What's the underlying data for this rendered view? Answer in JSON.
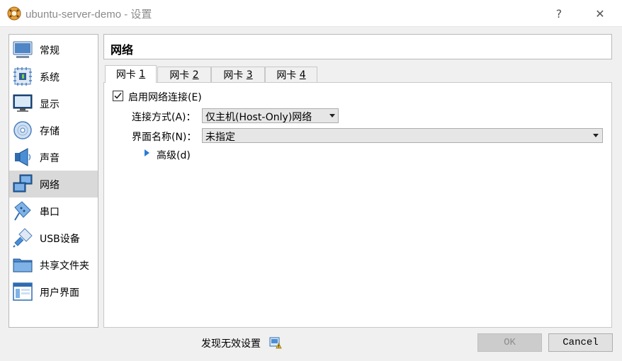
{
  "window": {
    "title": "ubuntu-server-demo - 设置",
    "help_glyph": "?",
    "close_glyph": "✕"
  },
  "sidebar": {
    "items": [
      {
        "label": "常规",
        "icon": "general-icon"
      },
      {
        "label": "系统",
        "icon": "system-chip-icon"
      },
      {
        "label": "显示",
        "icon": "display-monitor-icon"
      },
      {
        "label": "存储",
        "icon": "storage-disc-icon"
      },
      {
        "label": "声音",
        "icon": "speaker-icon"
      },
      {
        "label": "网络",
        "icon": "network-icon",
        "selected": true
      },
      {
        "label": "串口",
        "icon": "serial-port-icon"
      },
      {
        "label": "USB设备",
        "icon": "usb-icon"
      },
      {
        "label": "共享文件夹",
        "icon": "shared-folder-icon"
      },
      {
        "label": "用户界面",
        "icon": "user-interface-icon"
      }
    ]
  },
  "header": {
    "title": "网络"
  },
  "tabs": [
    {
      "prefix": "网卡 ",
      "key": "1",
      "active": true
    },
    {
      "prefix": "网卡 ",
      "key": "2"
    },
    {
      "prefix": "网卡 ",
      "key": "3"
    },
    {
      "prefix": "网卡 ",
      "key": "4"
    }
  ],
  "adapter": {
    "enable_label": "启用网络连接(E)",
    "enabled": true,
    "attach_label": "连接方式(A)：",
    "attach_value": "仅主机(Host-Only)网络",
    "name_label": "界面名称(N)：",
    "name_value": "未指定",
    "advanced_label": "高级(d)"
  },
  "footer": {
    "warning_text": "发现无效设置",
    "ok_label": "OK",
    "cancel_label": "Cancel"
  },
  "colors": {
    "accent": "#2a7bd3",
    "selected_bg": "#d9d9d9"
  }
}
